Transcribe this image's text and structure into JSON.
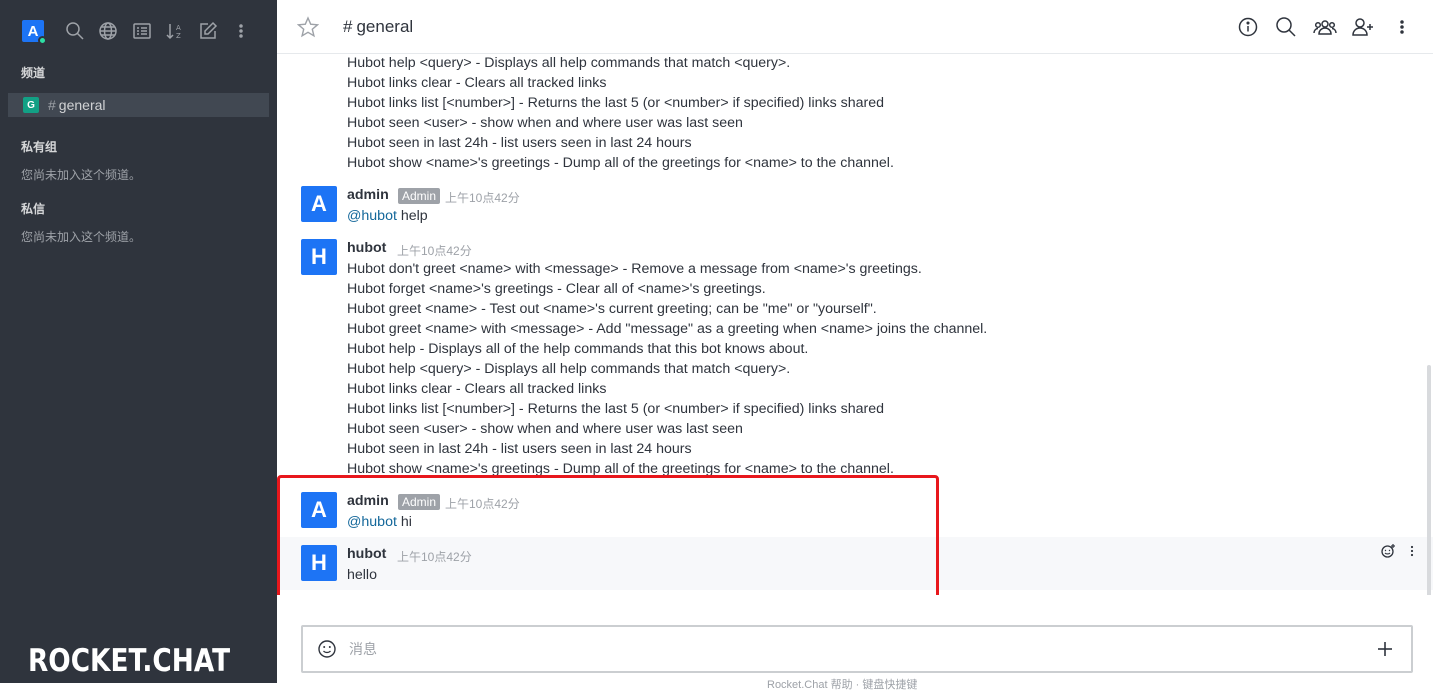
{
  "sidebar": {
    "avatar_letter": "A",
    "tools": [
      "search-icon",
      "directory-icon",
      "view-mode-icon",
      "sort-icon",
      "create-new-icon",
      "menu-kebab-icon"
    ],
    "sections": {
      "channels": "频道",
      "private_groups": "私有组",
      "private_groups_empty": "您尚未加入这个频道。",
      "direct_messages": "私信",
      "direct_messages_empty": "您尚未加入这个频道。"
    },
    "channel": {
      "avatar_letter": "G",
      "hash": "#",
      "name": "general"
    },
    "logo_text": "ROCKET.CHAT"
  },
  "header": {
    "hash": "#",
    "title": "general",
    "icons": [
      "info-icon",
      "search-icon",
      "members-icon",
      "add-user-icon",
      "kebab-menu-icon"
    ]
  },
  "messages": {
    "top_continuation": [
      "Hubot help <query> - Displays all help commands that match <query>.",
      "Hubot links clear - Clears all tracked links",
      "Hubot links list [<number>] - Returns the last 5 (or <number> if specified) links shared",
      "Hubot seen <user> - show when and where user was last seen",
      "Hubot seen in last 24h - list users seen in last 24 hours",
      "Hubot show <name>'s greetings - Dump all of the greetings for <name> to the channel."
    ],
    "msg1": {
      "avatar": "A",
      "user": "admin",
      "badge": "Admin",
      "time": "上午10点42分",
      "mention": "@hubot",
      "text": " help"
    },
    "msg2": {
      "avatar": "H",
      "user": "hubot",
      "time": "上午10点42分",
      "lines": [
        "Hubot don't greet <name> with <message> - Remove a message from <name>'s greetings.",
        "Hubot forget <name>'s greetings - Clear all of <name>'s greetings.",
        "Hubot greet <name> - Test out <name>'s current greeting; can be \"me\" or \"yourself\".",
        "Hubot greet <name> with <message> - Add \"message\" as a greeting when <name> joins the channel.",
        "Hubot help - Displays all of the help commands that this bot knows about.",
        "Hubot help <query> - Displays all help commands that match <query>.",
        "Hubot links clear - Clears all tracked links",
        "Hubot links list [<number>] - Returns the last 5 (or <number> if specified) links shared",
        "Hubot seen <user> - show when and where user was last seen",
        "Hubot seen in last 24h - list users seen in last 24 hours",
        "Hubot show <name>'s greetings - Dump all of the greetings for <name> to the channel."
      ]
    },
    "msg3": {
      "avatar": "A",
      "user": "admin",
      "badge": "Admin",
      "time": "上午10点42分",
      "mention": "@hubot",
      "text": " hi"
    },
    "msg4": {
      "avatar": "H",
      "user": "hubot",
      "time": "上午10点42分",
      "text": "hello"
    }
  },
  "composer": {
    "placeholder": "消息",
    "footer": "Rocket.Chat 帮助 · 键盘快捷键"
  },
  "colors": {
    "sidebar_bg": "#2f343d",
    "avatar_blue": "#1d74f5",
    "channel_avatar": "#12a085",
    "highlight_red": "#e8171c",
    "mention": "#13679a"
  }
}
